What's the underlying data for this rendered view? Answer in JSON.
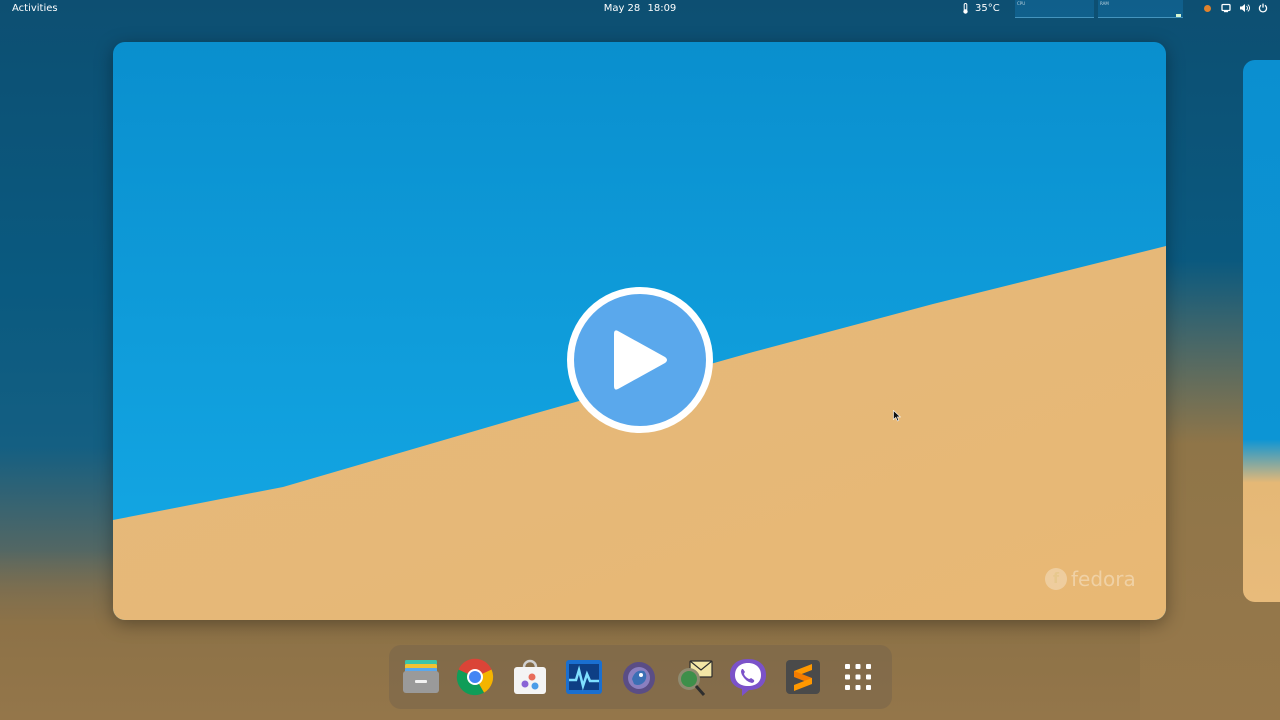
{
  "topbar": {
    "activities": "Activities",
    "date": "May 28",
    "time": "18:09",
    "temperature": "35°C",
    "graph_labels": [
      "CPU",
      "RAM"
    ],
    "status_color": "#e0822d",
    "tray_icons": [
      "screen-icon",
      "volume-icon",
      "power-icon"
    ]
  },
  "desktop": {
    "watermark": "fedora",
    "watermark_mark": "f",
    "video_accent": "#5aa8ec"
  },
  "dock": {
    "apps": [
      {
        "name": "files",
        "icon": "files-icon"
      },
      {
        "name": "chrome",
        "icon": "chrome-icon"
      },
      {
        "name": "software",
        "icon": "software-icon"
      },
      {
        "name": "system-monitor",
        "icon": "system-monitor-icon"
      },
      {
        "name": "gimp",
        "icon": "gimp-icon"
      },
      {
        "name": "mail",
        "icon": "mail-icon"
      },
      {
        "name": "viber",
        "icon": "viber-icon"
      },
      {
        "name": "sublime-text",
        "icon": "sublime-text-icon"
      },
      {
        "name": "show-apps",
        "icon": "app-grid-icon"
      }
    ]
  }
}
